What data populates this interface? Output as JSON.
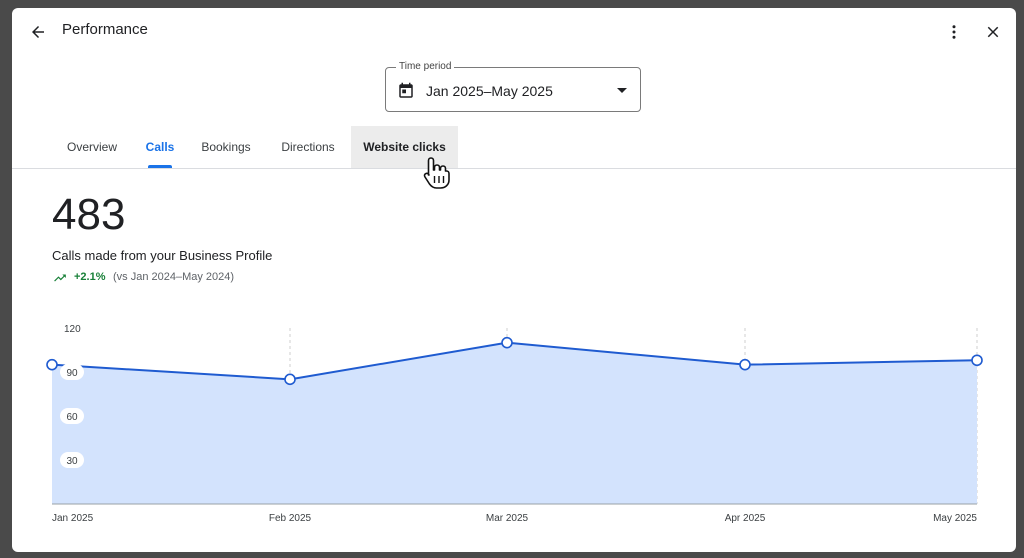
{
  "header": {
    "title": "Performance",
    "back_icon": "arrow-left-icon",
    "more_icon": "more-vert-icon",
    "close_icon": "close-icon"
  },
  "time_period": {
    "label": "Time period",
    "value": "Jan 2025–May 2025",
    "icon": "calendar-icon"
  },
  "tabs": [
    {
      "label": "Overview"
    },
    {
      "label": "Calls"
    },
    {
      "label": "Bookings"
    },
    {
      "label": "Directions"
    },
    {
      "label": "Website clicks"
    }
  ],
  "active_tab": "Calls",
  "hovered_tab": "Website clicks",
  "metric": {
    "value": "483",
    "label": "Calls made from your Business Profile",
    "change": "+2.1%",
    "comparison": "(vs Jan 2024–May 2024)"
  },
  "colors": {
    "accent": "#1a73e8",
    "line": "#1f5bd0",
    "area": "#d3e3fd",
    "positive": "#188038"
  },
  "chart_data": {
    "type": "area",
    "categories": [
      "Jan 2025",
      "Feb 2025",
      "Mar 2025",
      "Apr 2025",
      "May 2025"
    ],
    "series": [
      {
        "values": [
          95,
          85,
          110,
          95,
          98
        ]
      }
    ],
    "ylim": [
      0,
      120
    ],
    "yticks": [
      "30",
      "60",
      "90",
      "120"
    ],
    "grid": "vertical dashed",
    "title": "",
    "xlabel": "",
    "ylabel": ""
  }
}
